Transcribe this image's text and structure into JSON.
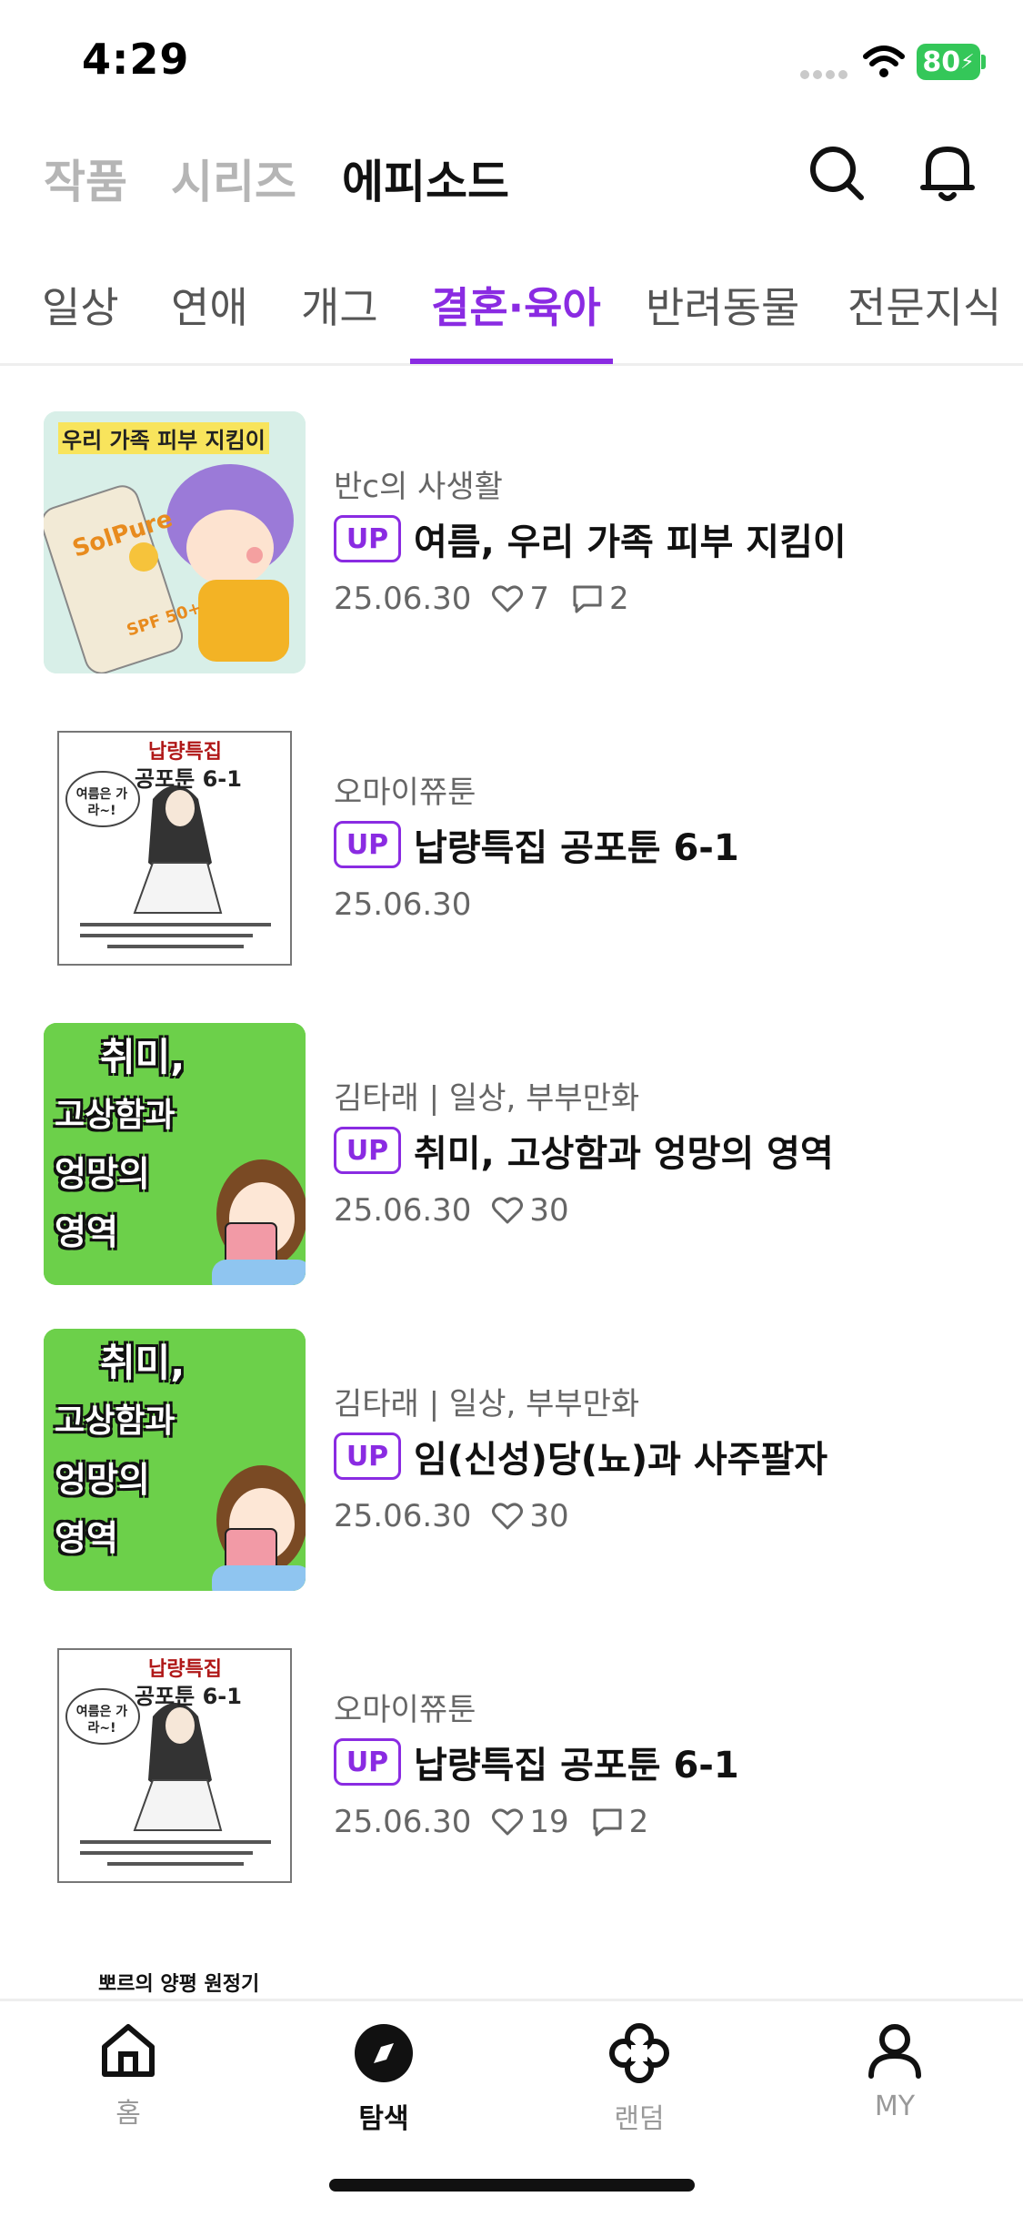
{
  "status": {
    "time": "4:29",
    "battery": "80"
  },
  "header": {
    "tabs": [
      {
        "label": "작품"
      },
      {
        "label": "시리즈"
      },
      {
        "label": "에피소드"
      }
    ],
    "active_tab": "에피소드",
    "icons": [
      "search-icon",
      "bell-icon"
    ]
  },
  "categories": {
    "tabs": [
      "일상",
      "연애",
      "개그",
      "결혼·육아",
      "반려동물",
      "전문지식"
    ],
    "active": "결혼·육아",
    "accent": "#8a2be2"
  },
  "thumb_text": {
    "t1": "우리 가족 피부 지킴이",
    "t1_brand": "SolPure",
    "t1_spf": "SPF 50+",
    "t2_title": "납량특집",
    "t2_sub": "공포툰 6-1",
    "t2_bubble": "여름은 가라~!",
    "t3_lines": [
      "취미,",
      "고상함과",
      "엉망의",
      "영역"
    ],
    "t6": "뽀르의 양평 원정기"
  },
  "episodes": [
    {
      "author": "반c의 사생활",
      "badge": "UP",
      "title": "여름, 우리 가족 피부 지킴이",
      "date": "25.06.30",
      "likes": "7",
      "comments": "2"
    },
    {
      "author": "오마이쮸툰",
      "badge": "UP",
      "title": "납량특집 공포툰 6-1",
      "date": "25.06.30"
    },
    {
      "author": "김타래 | 일상, 부부만화",
      "badge": "UP",
      "title": "취미, 고상함과 엉망의 영역",
      "date": "25.06.30",
      "likes": "30"
    },
    {
      "author": "김타래 | 일상, 부부만화",
      "badge": "UP",
      "title": "임(신성)당(뇨)과 사주팔자",
      "date": "25.06.30",
      "likes": "30"
    },
    {
      "author": "오마이쮸툰",
      "badge": "UP",
      "title": "납량특집 공포툰 6-1",
      "date": "25.06.30",
      "likes": "19",
      "comments": "2"
    }
  ],
  "bottom_nav": [
    {
      "label": "홈",
      "icon": "home-icon"
    },
    {
      "label": "탐색",
      "icon": "compass-icon"
    },
    {
      "label": "랜덤",
      "icon": "clover-icon"
    },
    {
      "label": "MY",
      "icon": "person-icon"
    }
  ],
  "active_nav": "탐색"
}
